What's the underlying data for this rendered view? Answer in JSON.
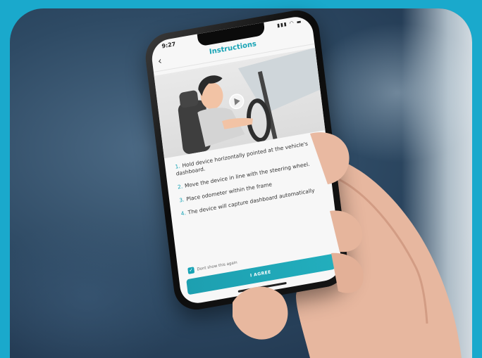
{
  "status": {
    "time": "9:27",
    "icons": "▮▮▮ ◠ ▬"
  },
  "header": {
    "back_icon": "chevron-left-icon",
    "title": "Instructions"
  },
  "video": {
    "play_icon": "play-icon"
  },
  "steps": [
    {
      "num": "1.",
      "text": "Hold device horizontally pointed at the vehicle's dashboard."
    },
    {
      "num": "2.",
      "text": "Move the device in line with the steering wheel."
    },
    {
      "num": "3.",
      "text": "Place odometer within the frame"
    },
    {
      "num": "4.",
      "text": "The device will capture dashboard automatically"
    }
  ],
  "checkbox": {
    "label": "Dont show this again",
    "checked": true
  },
  "agree_button": {
    "label": "I AGREE"
  },
  "colors": {
    "accent": "#17a3b5",
    "background": "#1aa9cc"
  }
}
